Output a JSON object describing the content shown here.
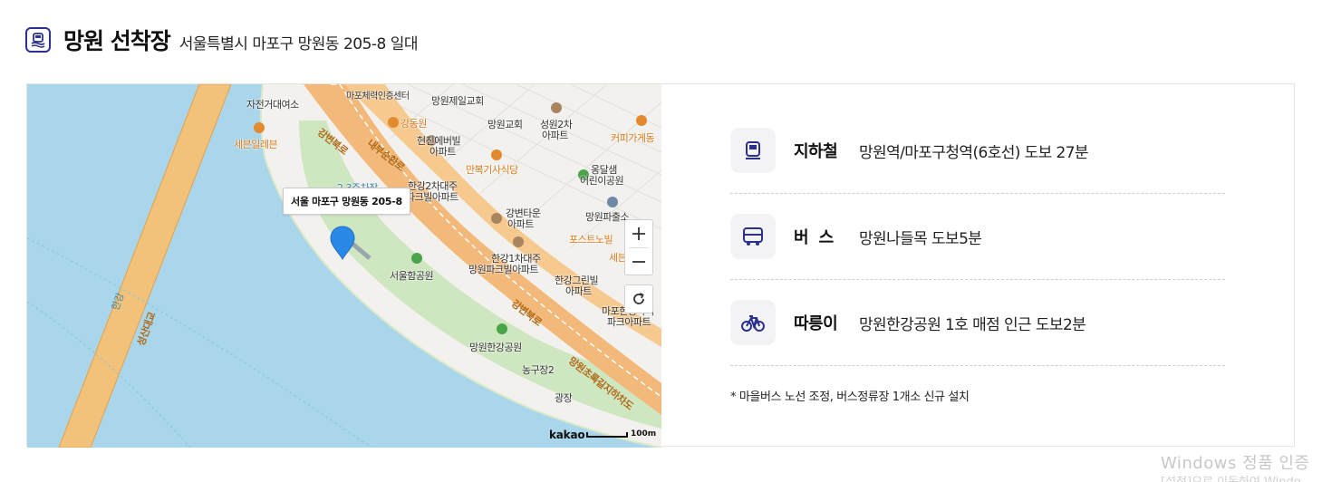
{
  "header": {
    "title": "망원 선착장",
    "address": "서울특별시 마포구 망원동 205-8 일대"
  },
  "map": {
    "callout": "서울 마포구 망원동 205-8",
    "brand": "kakao",
    "scale": "100m",
    "labels": {
      "bicycle_rental": "자전거대여소",
      "seven_eleven": "세븐일레븐",
      "parking": "2.3주차장",
      "gangbyeon_road": "강변북로",
      "naebu_road": "내부순환로",
      "gangdong": "강동원",
      "hyeonjin": "현진에버빌",
      "hyeonjin2": "아파트",
      "mangwon_church1": "망원제일교회",
      "mangwon_church2": "망원교회",
      "seongwon": "성원2차",
      "seongwon2": "아파트",
      "coffee": "커피가게동",
      "manbok": "만복기사식당",
      "hangang2": "한강2차대주",
      "hangang2b": "파크빌아파트",
      "ongdalsaem": "옹달샘",
      "ongdalsaem2": "어린이공원",
      "gangbyeon_town": "강변타운",
      "gangbyeon_town2": "아파트",
      "police": "망원파출소",
      "post_nobil": "포스트노빌",
      "seven2": "세븐",
      "hangang1": "한강1차대주",
      "hangang1b": "망원파크빌아파트",
      "seoul_ham": "서울함공원",
      "hangang_green": "한강그린빌",
      "hangang_green2": "아파트",
      "mapo_hangang": "마포한강아이",
      "mapo_hangang2": "파크아파트",
      "gangbyeon_road2": "강변북로",
      "mangwon_park": "망원한강공원",
      "basketball": "농구장2",
      "plaza": "광장",
      "mangwon_tunnel": "망원초록길지하차도",
      "river": "한강",
      "seongsan_bridge": "성산대교",
      "sports": "마포체력인증센터"
    }
  },
  "transport": [
    {
      "icon": "subway-icon",
      "label": "지하철",
      "value": "망원역/마포구청역(6호선) 도보 27분"
    },
    {
      "icon": "bus-icon",
      "label": "버  스",
      "value": "망원나들목 도보5분"
    },
    {
      "icon": "bicycle-icon",
      "label": "따릉이",
      "value": "망원한강공원 1호 매점 인근 도보2분"
    }
  ],
  "note": "* 마을버스 노선 조정, 버스정류장 1개소 신규 설치",
  "watermark": {
    "title": "Windows 정품 인증",
    "subtitle": "[설정]으로 이동하여 Windo"
  },
  "colors": {
    "accent": "#2b2f8f",
    "river": "#a9d6ea",
    "road": "#f3b97a",
    "park": "#cfe7c0",
    "pin": "#2a88e6"
  }
}
